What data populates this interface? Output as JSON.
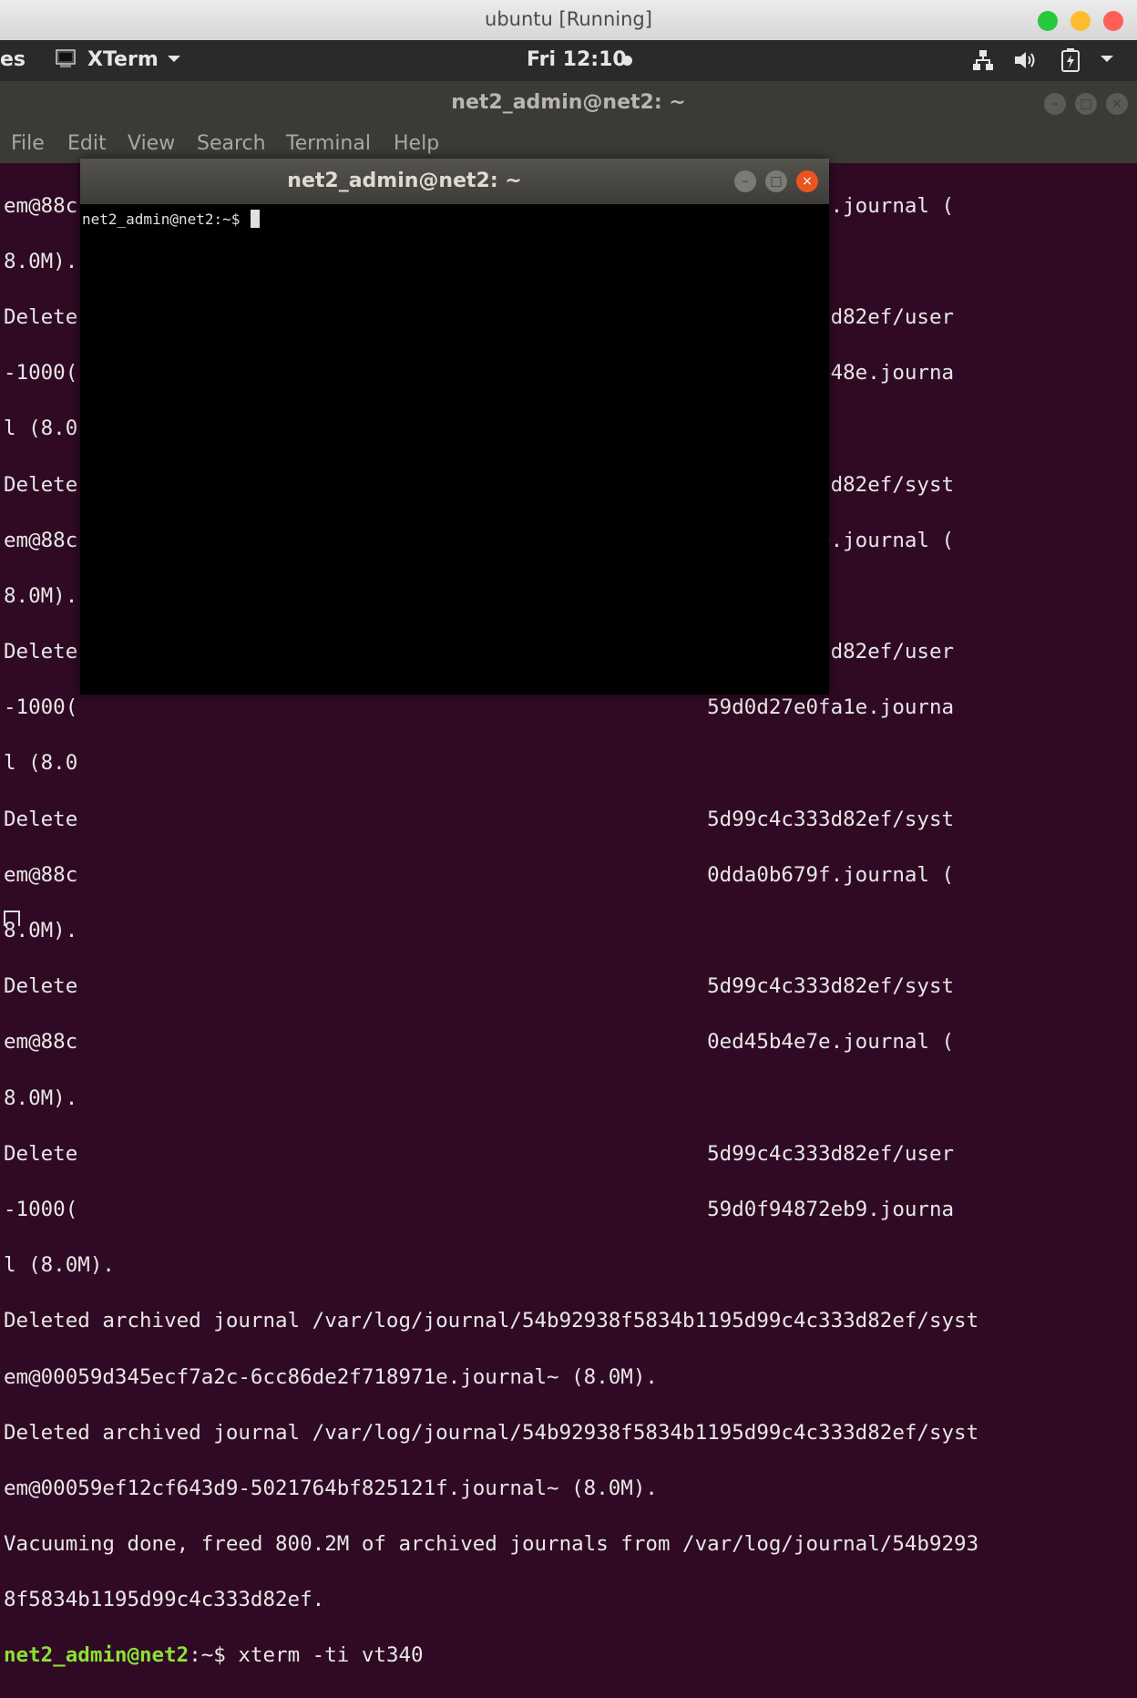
{
  "host": {
    "title": "ubuntu [Running]",
    "buttons": {
      "green": "#27c93f",
      "yellow": "#ffbd2e",
      "red": "#ff5f56"
    }
  },
  "topbar": {
    "left_cut": "es",
    "app_icon": "terminal-icon",
    "app_name": "XTerm",
    "app_arrow": "chevron-down-icon",
    "clock": "Fri 12:10",
    "status_icons": [
      "network-icon",
      "volume-icon",
      "battery-icon",
      "chevron-down-icon"
    ]
  },
  "main_terminal": {
    "title": "net2_admin@net2: ~",
    "menu": [
      "File",
      "Edit",
      "View",
      "Search",
      "Terminal",
      "Help"
    ],
    "lines": [
      "em@88c                                                   0c6e4b0e31.journal (",
      "8.0M).",
      "Delete                                                   5d99c4c333d82ef/user",
      "-1000(                                                   59d0cc141748e.journa",
      "l (8.0",
      "Delete                                                   5d99c4c333d82ef/syst",
      "em@88c                                                   0d036eaafe.journal (",
      "8.0M).",
      "Delete                                                   5d99c4c333d82ef/user",
      "-1000(                                                   59d0d27e0fa1e.journa",
      "l (8.0",
      "Delete                                                   5d99c4c333d82ef/syst",
      "em@88c                                                   0dda0b679f.journal (",
      "8.0M).",
      "Delete                                                   5d99c4c333d82ef/syst",
      "em@88c                                                   0ed45b4e7e.journal (",
      "8.0M).",
      "Delete                                                   5d99c4c333d82ef/user",
      "-1000(                                                   59d0f94872eb9.journa",
      "l (8.0M).",
      "Deleted archived journal /var/log/journal/54b92938f5834b1195d99c4c333d82ef/syst",
      "em@00059d345ecf7a2c-6cc86de2f718971e.journal~ (8.0M).",
      "Deleted archived journal /var/log/journal/54b92938f5834b1195d99c4c333d82ef/syst",
      "em@00059ef12cf643d9-5021764bf825121f.journal~ (8.0M).",
      "Vacuuming done, freed 800.2M of archived journals from /var/log/journal/54b9293",
      "8f5834b1195d99c4c333d82ef."
    ],
    "prompt_user": "net2_admin@net2",
    "prompt_path": ":~$ ",
    "prompt_command": "xterm -ti vt340"
  },
  "xterm": {
    "title": "net2_admin@net2: ~",
    "prompt": "net2_admin@net2:~$ "
  }
}
